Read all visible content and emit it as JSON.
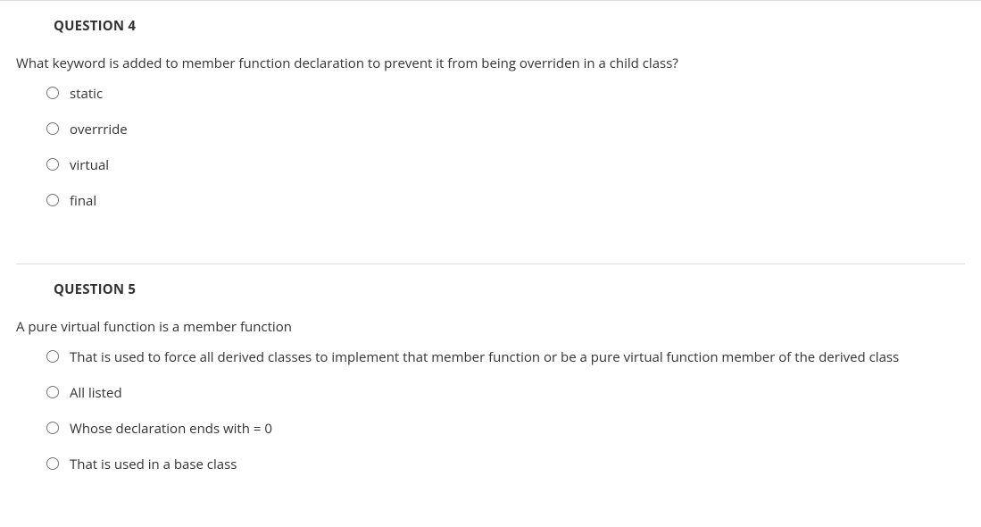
{
  "questions": [
    {
      "title": "QUESTION 4",
      "text": "What keyword is added to member function declaration to prevent it from being overriden in a child class?",
      "options": [
        "static",
        "overrride",
        "virtual",
        "final"
      ]
    },
    {
      "title": "QUESTION 5",
      "text": "A pure virtual function is a member function",
      "options": [
        "That is used to force all derived classes to implement that member function or be a pure virtual function member of the derived class",
        "All listed",
        "Whose declaration ends with = 0",
        "That is used in a base class"
      ]
    }
  ]
}
